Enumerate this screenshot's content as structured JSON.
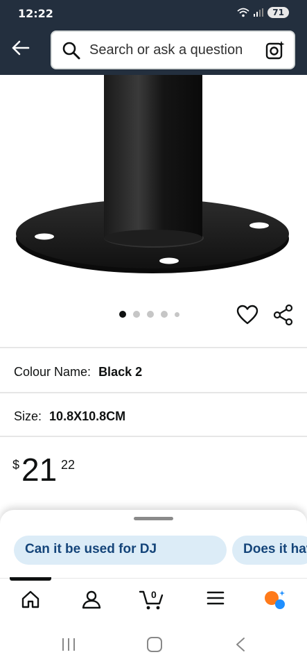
{
  "status": {
    "time": "12:22",
    "battery": "71"
  },
  "search": {
    "placeholder": "Search or ask a question"
  },
  "gallery": {
    "image_count": 5,
    "active_index": 0
  },
  "attributes": {
    "colour_label": "Colour Name:",
    "colour_value": "Black 2",
    "size_label": "Size:",
    "size_value": "10.8X10.8CM"
  },
  "price": {
    "currency": "$",
    "whole": "21",
    "fraction": "22"
  },
  "suggestions": [
    {
      "label": "Can it be used for DJ"
    },
    {
      "label": "Does it hav"
    }
  ],
  "nav": {
    "cart_count": "0"
  },
  "colors": {
    "header": "#232f3e",
    "chip_bg": "#dcecf7",
    "chip_text": "#15457a"
  }
}
